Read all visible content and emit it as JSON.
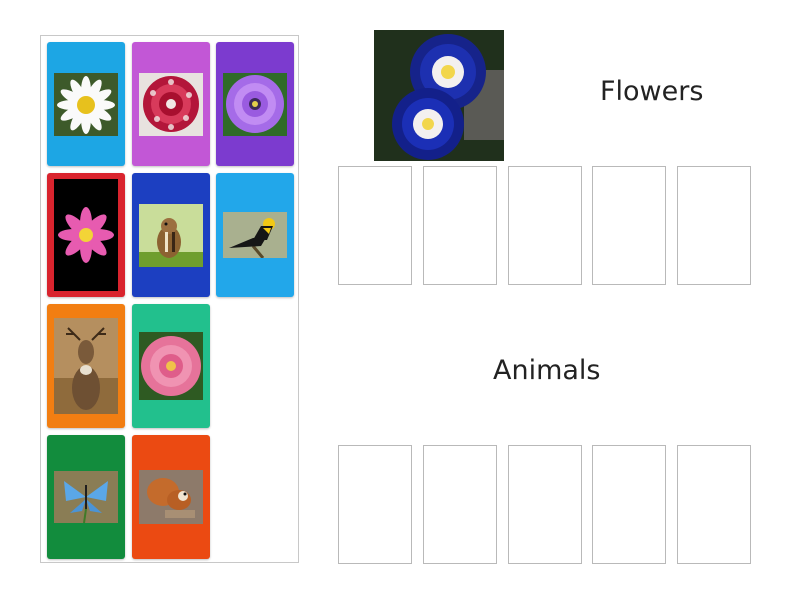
{
  "groups": [
    {
      "title": "Flowers",
      "slot_count": 5
    },
    {
      "title": "Animals",
      "slot_count": 5
    }
  ],
  "bank_cards": [
    {
      "item": "daisy",
      "color": "#1da6e4"
    },
    {
      "item": "red-dahlia",
      "color": "#c257d6"
    },
    {
      "item": "purple-dahlia",
      "color": "#7c3bcf"
    },
    {
      "item": "pink-lotus",
      "color": "#d9242e"
    },
    {
      "item": "chipmunk",
      "color": "#1c3fc1"
    },
    {
      "item": "yellow-headed-blackbird",
      "color": "#22a7ea"
    },
    {
      "item": "deer",
      "color": "#f27e12"
    },
    {
      "item": "pink-dahlia",
      "color": "#22c08d"
    },
    {
      "item": "blue-butterfly",
      "color": "#128c3d"
    },
    {
      "item": "red-squirrel",
      "color": "#eb4a12"
    }
  ],
  "header_image": {
    "item": "blue-morning-glory"
  }
}
